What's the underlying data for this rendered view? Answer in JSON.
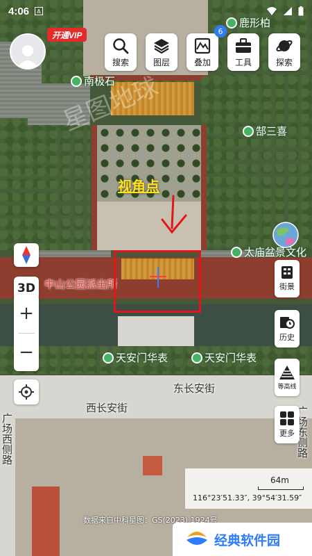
{
  "status_bar": {
    "time": "4:06",
    "notif_icon": "A"
  },
  "vip_label": "开通VIP",
  "toolbar": [
    {
      "label": "搜索",
      "icon": "search-icon"
    },
    {
      "label": "图层",
      "icon": "layers-icon"
    },
    {
      "label": "叠加",
      "icon": "overlay-icon",
      "badge": "6"
    },
    {
      "label": "工具",
      "icon": "toolbox-icon"
    },
    {
      "label": "探索",
      "icon": "planet-icon"
    }
  ],
  "left_controls": {
    "mode_3d": "3D",
    "zoom_in": "+",
    "zoom_out": "−"
  },
  "right_controls": [
    {
      "label": "街景",
      "icon": "street-view-icon"
    },
    {
      "label": "历史",
      "icon": "history-icon"
    },
    {
      "label": "等高线",
      "icon": "contour-icon"
    },
    {
      "label": "更多",
      "icon": "grid-more-icon"
    }
  ],
  "map": {
    "pois": [
      {
        "name": "鹿形柏"
      },
      {
        "name": "南极石"
      },
      {
        "name": "郜三喜"
      },
      {
        "name": "太庙盆景文化"
      },
      {
        "name": "天安门华表"
      },
      {
        "name": "天安门华表"
      }
    ],
    "red_label": "中山公园派出所",
    "roads": [
      "东长安街",
      "西长安街"
    ],
    "vertical_left": "广场西侧路",
    "vertical_right": "广场东侧路",
    "annotation": "视角点"
  },
  "scale": {
    "distance": "64m",
    "coordinates": "116°23′51.33″, 39°54′31.59″"
  },
  "source": "数据来自中科星图：GS(2023) 1924号",
  "brand": "经典软件园",
  "colors": {
    "accent": "#2f7cf6",
    "poi_pin": "#44b463",
    "vip": "#e32b2b",
    "annotation": "#ffe119",
    "highlight_box": "#e3141b"
  }
}
